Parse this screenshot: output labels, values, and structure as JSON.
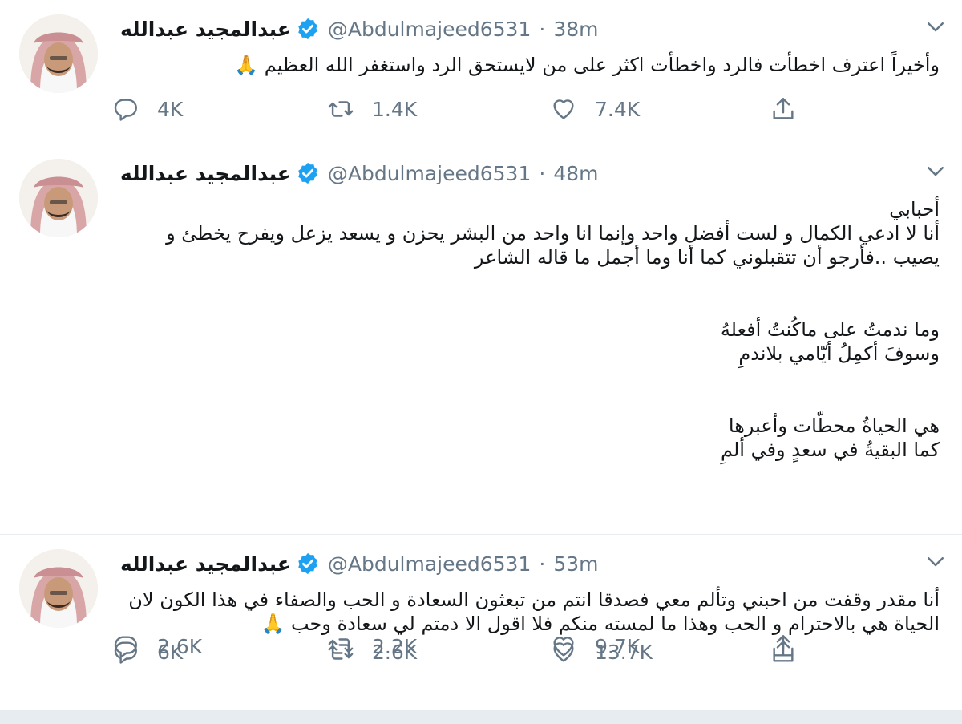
{
  "colors": {
    "text": "#14171a",
    "muted": "#657786",
    "verified": "#1da1f2",
    "divider": "#e6ecf0"
  },
  "icons": {
    "reply": "comment-bubble-icon",
    "retweet": "retweet-arrows-icon",
    "like": "heart-icon",
    "share": "share-upload-icon",
    "verified": "verified-badge-icon",
    "menu": "chevron-down-icon"
  },
  "tweets": [
    {
      "name": "عبدالمجيد عبدالله",
      "handle": "@Abdulmajeed6531",
      "separator": "·",
      "time": "38m",
      "lines": [
        "وأخيراً اعترف اخطأت فالرد واخطأت اكثر على من لايستحق الرد واستغفر الله العظيم 🙏"
      ],
      "replies": "4K",
      "retweets": "1.4K",
      "likes": "7.4K"
    },
    {
      "name": "عبدالمجيد عبدالله",
      "handle": "@Abdulmajeed6531",
      "separator": "·",
      "time": "48m",
      "lines": [
        "أحبابي",
        "أنا لا ادعي الكمال و لست أفضل واحد وإنما انا واحد من البشر يحزن و يسعد يزعل ويفرح يخطئ و",
        "يصيب ..فأرجو أن تتقبلوني كما أنا وما أجمل ما قاله الشاعر",
        "",
        "وما ندمتُ على ماكُنتُ أفعلهُ",
        "وسوفَ أكمِلُ أيّامي بلاندمِ",
        "",
        "هي الحياةُ محطّات وأعبرها",
        "كما البقيةُ في سعدٍ وفي ألمِ"
      ],
      "replies": "2.6K",
      "retweets": "2.2K",
      "likes": "9.7K"
    },
    {
      "name": "عبدالمجيد عبدالله",
      "handle": "@Abdulmajeed6531",
      "separator": "·",
      "time": "53m",
      "lines": [
        "أنا مقدر وقفت من احبني وتألم معي فصدقا انتم من تبعثون السعادة و الحب والصفاء في هذا الكون لان",
        "الحياة هي بالاحترام و الحب وهذا ما لمسته منكم فلا اقول الا دمتم لي سعادة وحب 🙏"
      ],
      "replies": "6K",
      "retweets": "2.6K",
      "likes": "13.7K"
    }
  ]
}
